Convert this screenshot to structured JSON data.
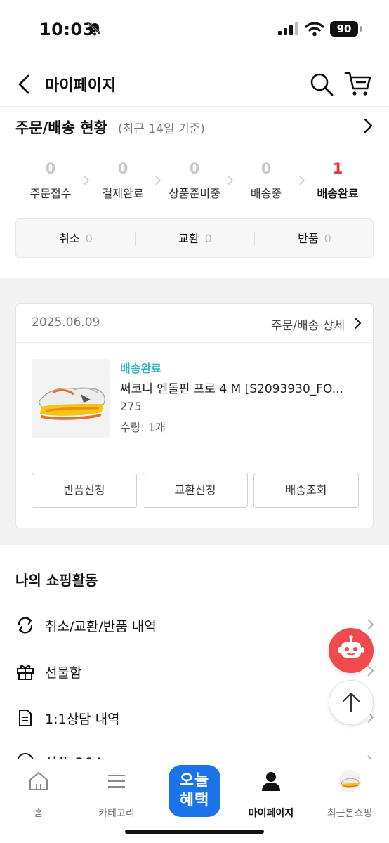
{
  "status_bar": {
    "time": "10:03",
    "battery": "90"
  },
  "header": {
    "title": "마이페이지"
  },
  "order_status": {
    "title": "주문/배송 현황",
    "subtitle": "(최근 14일 기준)",
    "steps": [
      {
        "count": "0",
        "label": "주문접수"
      },
      {
        "count": "0",
        "label": "결제완료"
      },
      {
        "count": "0",
        "label": "상품준비중"
      },
      {
        "count": "0",
        "label": "배송중"
      },
      {
        "count": "1",
        "label": "배송완료"
      }
    ],
    "claims": [
      {
        "label": "취소",
        "count": "0"
      },
      {
        "label": "교환",
        "count": "0"
      },
      {
        "label": "반품",
        "count": "0"
      }
    ]
  },
  "order": {
    "date": "2025.06.09",
    "detail_link": "주문/배송 상세",
    "status": "배송완료",
    "product_name": "써코니 엔돌핀 프로 4 M [S2093930_FO...",
    "size": "275",
    "quantity": "수량: 1개",
    "buttons": [
      "반품신청",
      "교환신청",
      "배송조회"
    ]
  },
  "shopping_activity": {
    "title": "나의 쇼핑활동",
    "items": [
      {
        "label": "취소/교환/반품 내역",
        "icon": "exchange-icon"
      },
      {
        "label": "선물함",
        "icon": "gift-icon"
      },
      {
        "label": "1:1상담 내역",
        "icon": "document-icon"
      },
      {
        "label": "상품 Q&A",
        "icon": "qna-icon"
      }
    ]
  },
  "tabbar": {
    "items": [
      {
        "label": "홈",
        "icon": "home-icon"
      },
      {
        "label": "카테고리",
        "icon": "menu-icon"
      },
      {
        "label": "오늘\n혜택",
        "icon": "today-benefit-icon"
      },
      {
        "label": "마이페이지",
        "icon": "person-icon"
      },
      {
        "label": "최근본쇼핑",
        "icon": "recent-product-thumbnail"
      }
    ],
    "today_line1": "오늘",
    "today_line2": "혜택"
  },
  "colors": {
    "accent_red": "#e7383a",
    "teal": "#35b3c1",
    "brand_blue": "#1a73e8",
    "bot_red": "#ef4a4d"
  }
}
